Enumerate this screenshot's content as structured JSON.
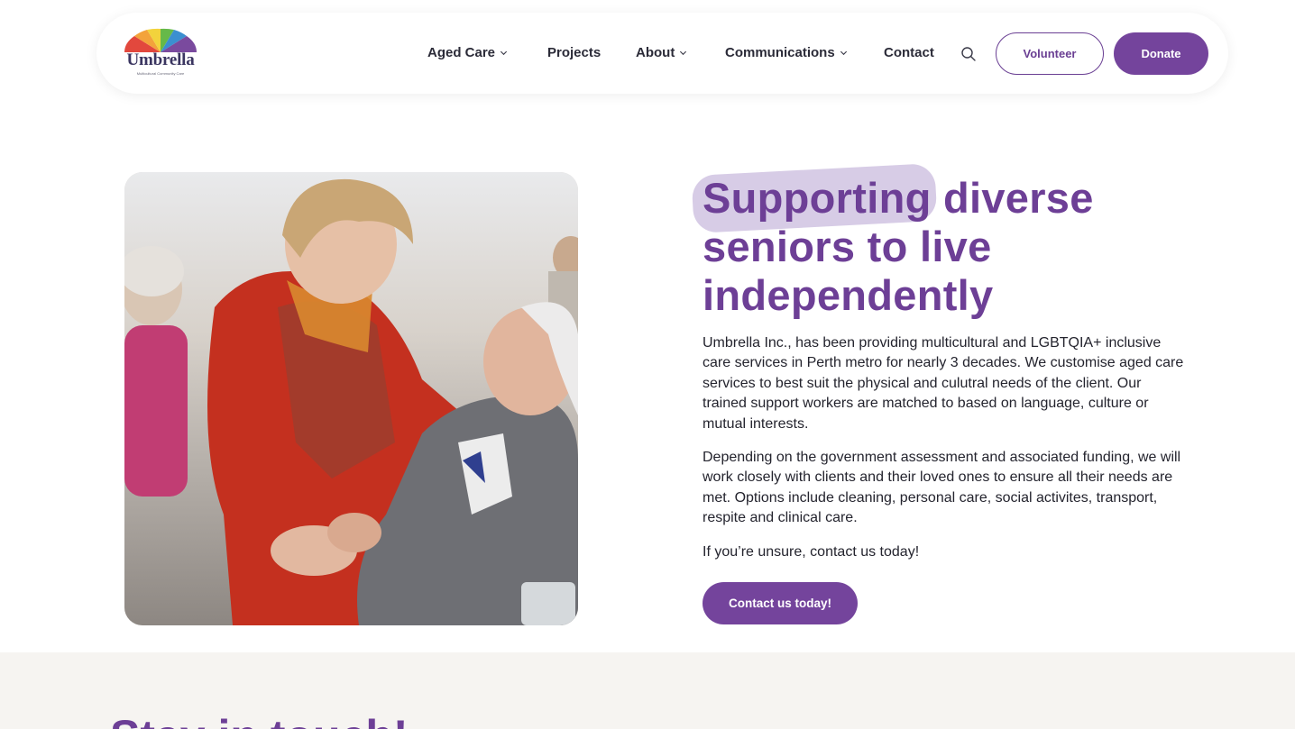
{
  "brand": {
    "name": "Umbrella",
    "tagline": "Multicultural Community Care",
    "primary_color": "#74449c",
    "heading_color": "#6d3f96",
    "highlight_color": "#d7cce6"
  },
  "nav": {
    "items": [
      {
        "label": "Aged Care",
        "has_dropdown": true
      },
      {
        "label": "Projects",
        "has_dropdown": false
      },
      {
        "label": "About",
        "has_dropdown": true
      },
      {
        "label": "Communications",
        "has_dropdown": true
      },
      {
        "label": "Contact",
        "has_dropdown": false
      }
    ],
    "search_icon": "search-icon",
    "volunteer_label": "Volunteer",
    "donate_label": "Donate"
  },
  "hero": {
    "image_description_icon": "photo",
    "title_lines": [
      "Supporting diverse",
      "seniors to live",
      "independently"
    ],
    "paragraphs": [
      "Umbrella Inc., has been providing multicultural and LGBTQIA+ inclusive care services in Perth metro for nearly 3 decades. We customise aged care services to best suit the physical and culutral needs of the client. Our trained support workers are matched to based on language, culture or mutual interests.",
      "Depending on the government assessment and associated funding, we will work closely with clients and their loved ones to ensure all their needs are met. Options include cleaning, personal care, social activites, transport, respite and clinical care.",
      "If you’re unsure, contact us today!"
    ],
    "cta_label": "Contact us today!"
  },
  "bottom": {
    "title": "Stay in touch!"
  }
}
